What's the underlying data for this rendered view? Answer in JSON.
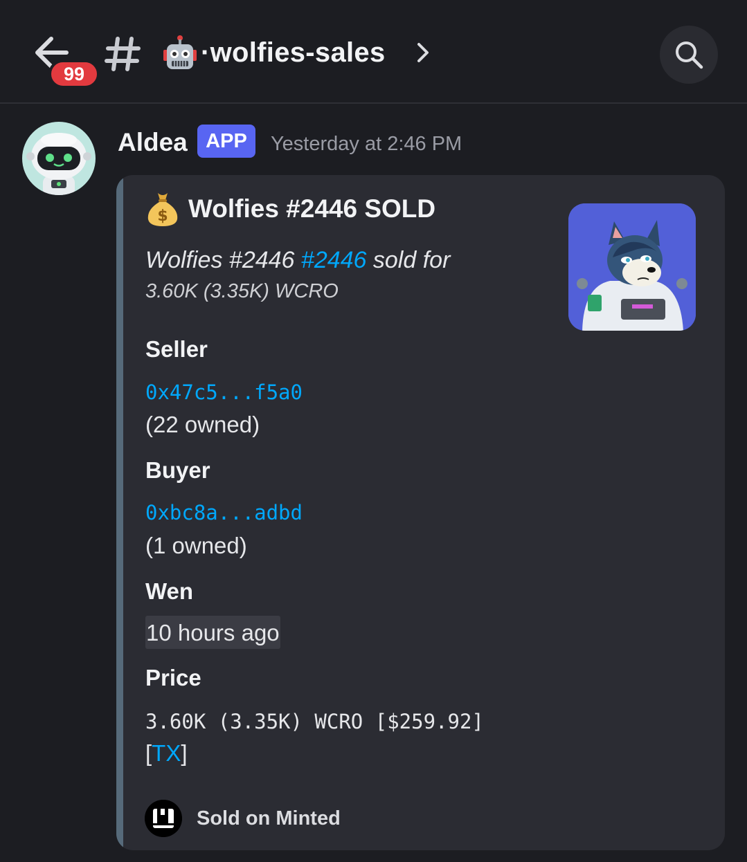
{
  "header": {
    "unread_count": "99",
    "channel_name": "·wolfies-sales",
    "channel_emoji": "robot-icon"
  },
  "message": {
    "author": "Aldea",
    "app_badge": "APP",
    "timestamp": "Yesterday at 2:46 PM",
    "embed": {
      "title_emoji": "money-bag-icon",
      "title": "Wolfies #2446 SOLD",
      "desc_prefix": "Wolfies #2446 ",
      "desc_link": "#2446",
      "desc_suffix": " sold for",
      "desc_line2": "3.60K (3.35K) WCRO",
      "fields": {
        "seller_name": "Seller",
        "seller_addr": "0x47c5...f5a0",
        "seller_owned": "(22 owned)",
        "buyer_name": "Buyer",
        "buyer_addr": "0xbc8a...adbd",
        "buyer_owned": "(1 owned)",
        "wen_name": "Wen",
        "wen_value": "10 hours ago",
        "price_name": "Price",
        "price_value": "3.60K (3.35K) WCRO [$259.92]",
        "tx_open": "[",
        "tx_link": "TX",
        "tx_close": "]"
      },
      "footer": "Sold on Minted"
    }
  },
  "colors": {
    "accent": "#5865f2",
    "link": "#00a8fc",
    "badge": "#e23a3f",
    "embed_bar": "#566a7a"
  }
}
